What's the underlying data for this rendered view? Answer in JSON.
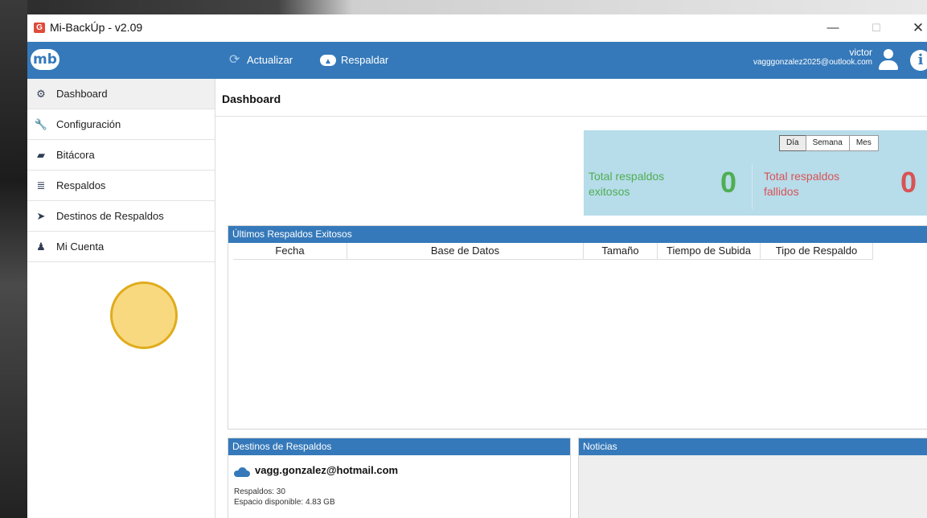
{
  "window": {
    "title": "Mi-BackÚp - v2.09",
    "icon": "app-logo-icon",
    "controls": {
      "minimize": "—",
      "maximize": "☐",
      "close": "✕"
    }
  },
  "header": {
    "logo_text": "mb",
    "toolbar": [
      {
        "label": "Actualizar",
        "icon": "refresh-icon"
      },
      {
        "label": "Respaldar",
        "icon": "cloud-upload-icon"
      }
    ],
    "user": {
      "name": "victor",
      "email": "vagggonzalez2025@outlook.com"
    },
    "info_icon_glyph": "i",
    "accent_color": "#3579ba"
  },
  "sidebar": {
    "items": [
      {
        "label": "Dashboard",
        "icon": "dashboard-icon",
        "glyph": "⚙",
        "active": true
      },
      {
        "label": "Configuración",
        "icon": "wrench-icon",
        "glyph": "🔧"
      },
      {
        "label": "Bitácora",
        "icon": "book-icon",
        "glyph": "▰"
      },
      {
        "label": "Respaldos",
        "icon": "database-icon",
        "glyph": "≣"
      },
      {
        "label": "Destinos de Respaldos",
        "icon": "send-icon",
        "glyph": "➤"
      },
      {
        "label": "Mi Cuenta",
        "icon": "user-icon",
        "glyph": "♟"
      }
    ]
  },
  "main": {
    "title": "Dashboard",
    "stats": {
      "range_tabs": [
        "Día",
        "Semana",
        "Mes"
      ],
      "selected_range": "Día",
      "success_label": "Total respaldos exitosos",
      "success_count": "0",
      "success_color": "#4fae52",
      "failed_label": "Total respaldos fallidos",
      "failed_count": "0",
      "failed_color": "#d95355"
    },
    "recent_backups": {
      "title": "Últimos Respaldos Exitosos",
      "columns": [
        "Fecha",
        "Base de Datos",
        "Tamaño",
        "Tiempo de Subida",
        "Tipo de Respaldo"
      ],
      "rows": []
    },
    "destinations": {
      "title": "Destinos de Respaldos",
      "items": [
        {
          "icon": "onedrive-cloud-icon",
          "email": "vagg.gonzalez@hotmail.com",
          "backups": "Respaldos: 30",
          "space": "Espacio disponible: 4.83 GB"
        }
      ]
    },
    "news": {
      "title": "Noticias"
    }
  }
}
